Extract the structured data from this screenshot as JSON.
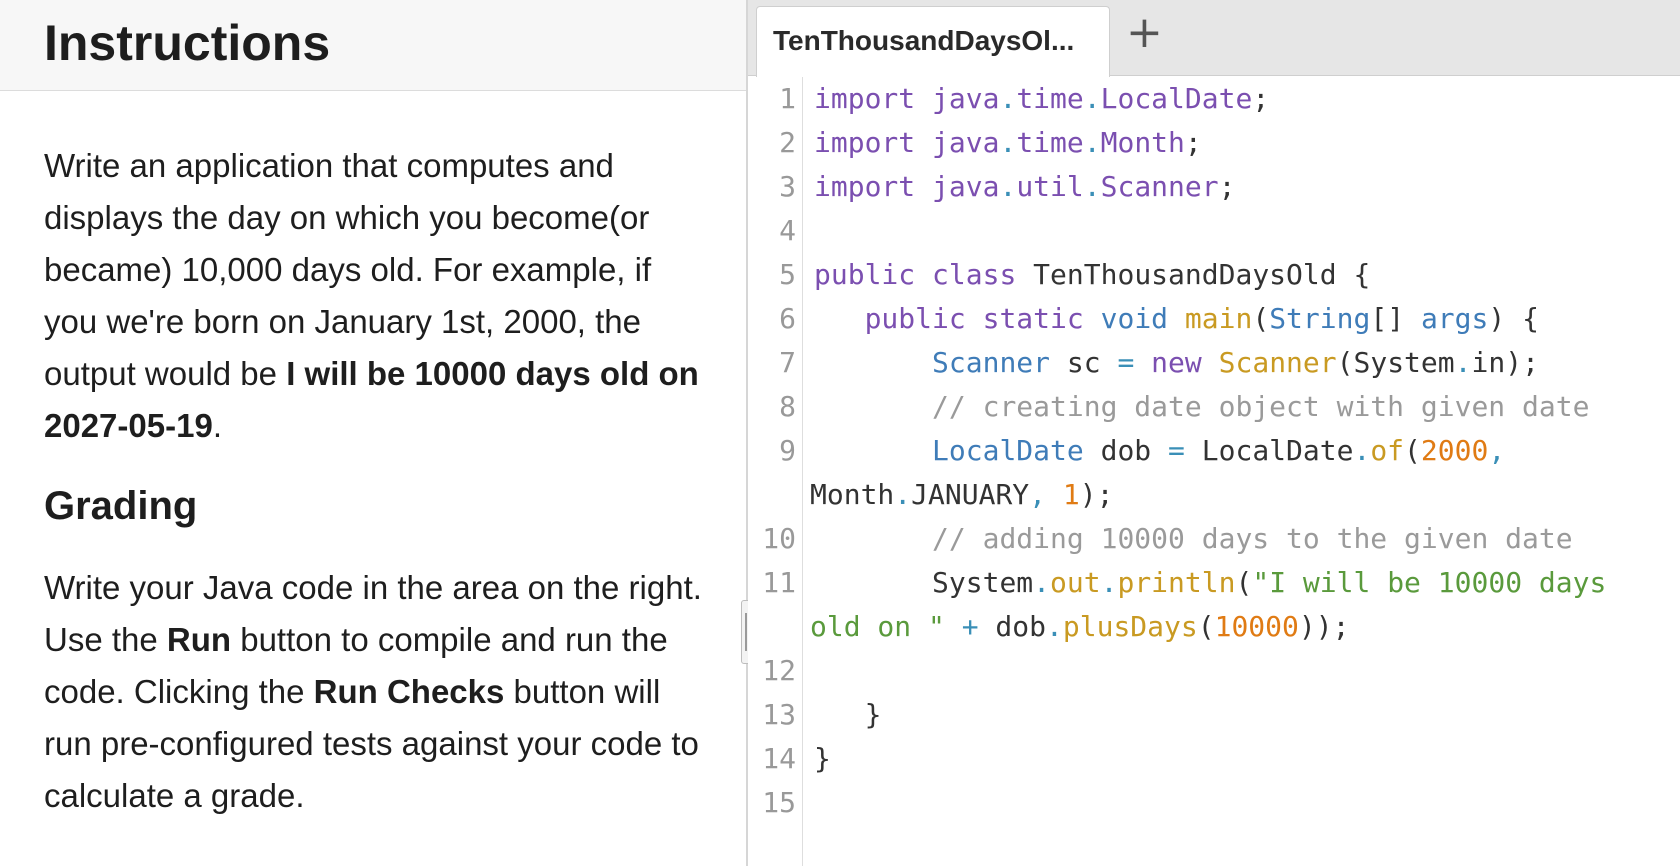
{
  "instructions": {
    "title": "Instructions",
    "para1_before": "Write an application that computes and displays the day on which you become(or became) 10,000 days old. For example, if you we're born on January 1st, 2000, the output would be ",
    "para1_bold": "I will be 10000 days old on 2027-05-19",
    "para1_after": ".",
    "grading_heading": "Grading",
    "para2_a": "Write your Java code in the area on the right. Use the ",
    "para2_run": "Run",
    "para2_b": " button to compile and run the code. Clicking the ",
    "para2_checks": "Run Checks",
    "para2_c": " button will run pre-configured tests against your code to calculate a grade."
  },
  "editor": {
    "tab_label": "TenThousandDaysOl...",
    "add_tab_symbol": "+",
    "line_numbers": [
      "1",
      "2",
      "3",
      "4",
      "5",
      "6",
      "7",
      "8",
      "9",
      "10",
      "11",
      "12",
      "13",
      "14",
      "15"
    ],
    "code": {
      "l1_kw": "import",
      "l1_pkg": " java",
      "l1_d1": ".",
      "l1_time": "time",
      "l1_d2": ".",
      "l1_cls": "LocalDate",
      "l1_end": ";",
      "l2_kw": "import",
      "l2_pkg": " java",
      "l2_d1": ".",
      "l2_time": "time",
      "l2_d2": ".",
      "l2_cls": "Month",
      "l2_end": ";",
      "l3_kw": "import",
      "l3_pkg": " java",
      "l3_d1": ".",
      "l3_util": "util",
      "l3_d2": ".",
      "l3_cls": "Scanner",
      "l3_end": ";",
      "l5_kw1": "public",
      "l5_kw2": " class",
      "l5_name": " TenThousandDaysOld {",
      "l6_indent": "   ",
      "l6_kw1": "public",
      "l6_kw2": " static",
      "l6_void": " void",
      "l6_main": " main",
      "l6_p1": "(",
      "l6_string": "String",
      "l6_br": "[] ",
      "l6_args": "args",
      "l6_end": ") {",
      "l7_indent": "       ",
      "l7_type": "Scanner",
      "l7_var": " sc ",
      "l7_eq": "=",
      "l7_new": " new",
      "l7_ctor": " Scanner",
      "l7_arg": "(System",
      "l7_dot": ".",
      "l7_in": "in);",
      "l8_indent": "       ",
      "l8_comment": "// creating date object with given date",
      "l9_indent": "       ",
      "l9_type": "LocalDate",
      "l9_var": " dob ",
      "l9_eq": "=",
      "l9_rhs": " LocalDate",
      "l9_dot": ".",
      "l9_of": "of",
      "l9_p": "(",
      "l9_num": "2000",
      "l9_comma": ",",
      "l9b_month": "Month",
      "l9b_dot": ".",
      "l9b_jan": "JANUARY",
      "l9b_comma": ",",
      "l9b_num": " 1",
      "l9b_end": ");",
      "l10_indent": "       ",
      "l10_comment": "// adding 10000 days to the given date",
      "l11_indent": "       ",
      "l11_sys": "System",
      "l11_d1": ".",
      "l11_out": "out",
      "l11_d2": ".",
      "l11_println": "println",
      "l11_p": "(",
      "l11_str": "\"I will be 10000 days",
      "l11b_str": "old on \"",
      "l11b_plus": " +",
      "l11b_dob": " dob",
      "l11b_dot": ".",
      "l11b_plus_days": "plusDays",
      "l11b_p": "(",
      "l11b_num": "10000",
      "l11b_end": "));",
      "l13_text": "   }",
      "l14_text": "}"
    }
  }
}
